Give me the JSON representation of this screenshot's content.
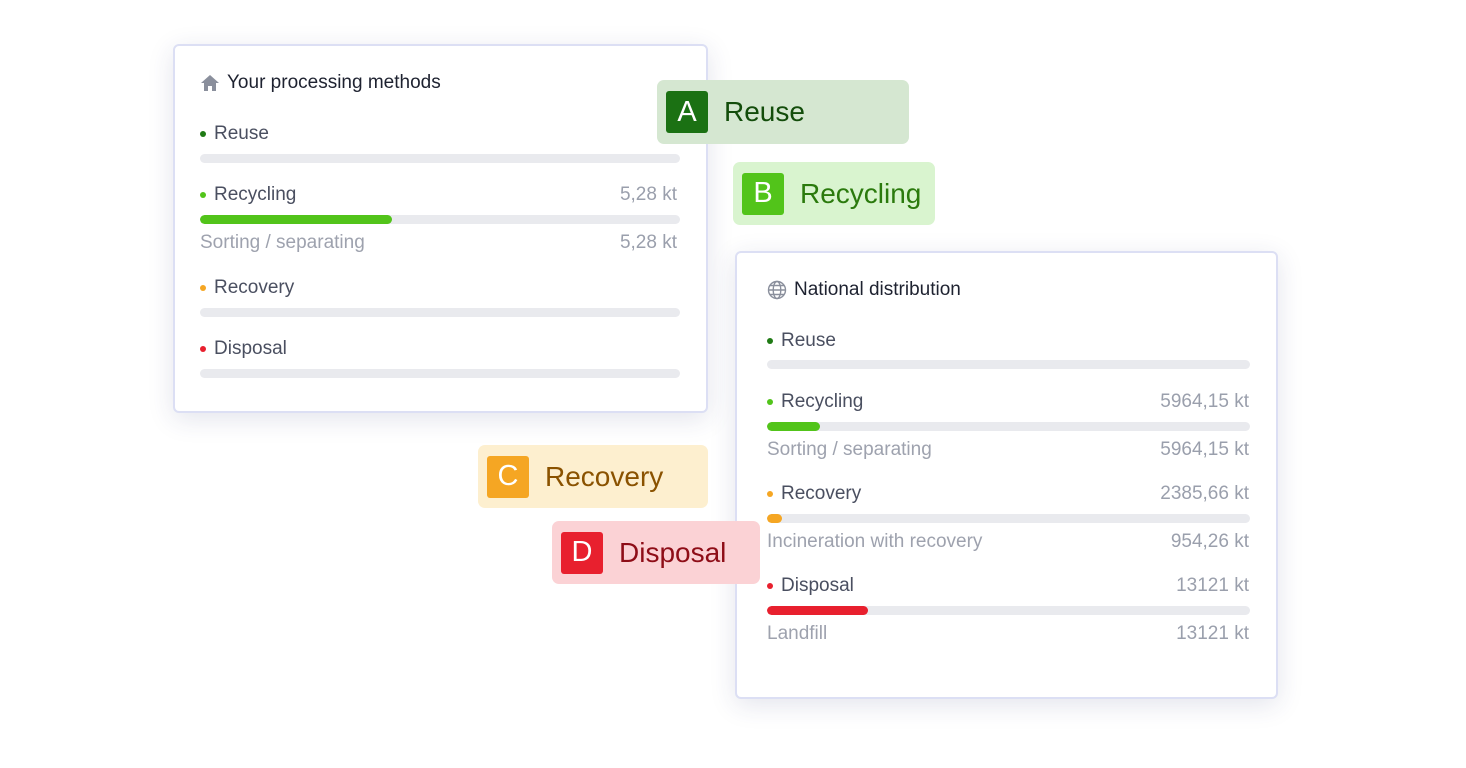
{
  "colors": {
    "reuse": "#1f7a14",
    "recycling": "#52c41a",
    "recovery": "#f5a623",
    "disposal": "#e8202e"
  },
  "left_card": {
    "title": "Your processing methods",
    "icon": "home-icon",
    "items": [
      {
        "label": "Reuse",
        "value": "",
        "progress": 0
      },
      {
        "label": "Recycling",
        "value": "5,28 kt",
        "progress": 0.4,
        "sub_label": "Sorting / separating",
        "sub_value": "5,28 kt"
      },
      {
        "label": "Recovery",
        "value": "",
        "progress": 0
      },
      {
        "label": "Disposal",
        "value": "",
        "progress": 0
      }
    ]
  },
  "right_card": {
    "title": "National distribution",
    "icon": "globe-icon",
    "items": [
      {
        "label": "Reuse",
        "value": "",
        "progress": 0
      },
      {
        "label": "Recycling",
        "value": "5964,15 kt",
        "progress": 0.11,
        "sub_label": "Sorting / separating",
        "sub_value": "5964,15 kt"
      },
      {
        "label": "Recovery",
        "value": "2385,66 kt",
        "progress": 0.03,
        "sub_label": "Incineration with recovery",
        "sub_value": "954,26 kt"
      },
      {
        "label": "Disposal",
        "value": "13121 kt",
        "progress": 0.21,
        "sub_label": "Landfill",
        "sub_value": "13121 kt"
      }
    ]
  },
  "tags": [
    {
      "letter": "A",
      "word": "Reuse"
    },
    {
      "letter": "B",
      "word": "Recycling"
    },
    {
      "letter": "C",
      "word": "Recovery"
    },
    {
      "letter": "D",
      "word": "Disposal"
    }
  ]
}
